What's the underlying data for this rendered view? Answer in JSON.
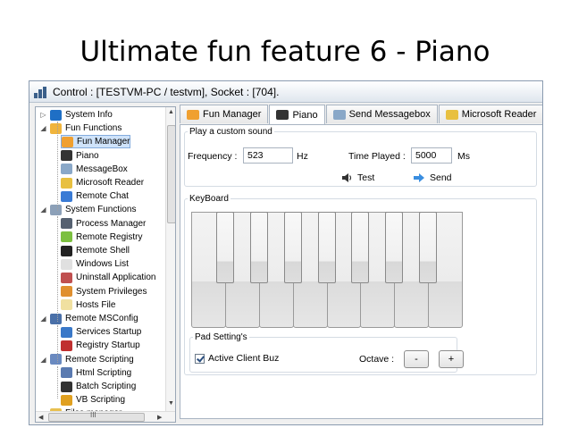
{
  "slide": {
    "title": "Ultimate fun feature 6 - Piano"
  },
  "window": {
    "title": "Control : [TESTVM-PC / testvm], Socket : [704]."
  },
  "tree": {
    "items": [
      {
        "label": "System Info",
        "level": 0,
        "expander": "▷",
        "icon": "info-icon",
        "color": "#1f6fc5"
      },
      {
        "label": "Fun Functions",
        "level": 0,
        "expander": "◢",
        "icon": "smiley-folder-icon",
        "color": "#f0b43c"
      },
      {
        "label": "Fun Manager",
        "level": 1,
        "expander": "",
        "icon": "fun-manager-icon",
        "color": "#f0a030",
        "selected": true
      },
      {
        "label": "Piano",
        "level": 1,
        "expander": "",
        "icon": "piano-icon",
        "color": "#333333"
      },
      {
        "label": "MessageBox",
        "level": 1,
        "expander": "",
        "icon": "messagebox-icon",
        "color": "#8aa8c8"
      },
      {
        "label": "Microsoft Reader",
        "level": 1,
        "expander": "",
        "icon": "reader-icon",
        "color": "#e8c040"
      },
      {
        "label": "Remote Chat",
        "level": 1,
        "expander": "",
        "icon": "chat-icon",
        "color": "#3a7bd5"
      },
      {
        "label": "System Functions",
        "level": 0,
        "expander": "◢",
        "icon": "system-functions-icon",
        "color": "#8ca0b8"
      },
      {
        "label": "Process Manager",
        "level": 1,
        "expander": "",
        "icon": "process-manager-icon",
        "color": "#556070"
      },
      {
        "label": "Remote Registry",
        "level": 1,
        "expander": "",
        "icon": "registry-icon",
        "color": "#7cc040"
      },
      {
        "label": "Remote Shell",
        "level": 1,
        "expander": "",
        "icon": "shell-icon",
        "color": "#222222"
      },
      {
        "label": "Windows List",
        "level": 1,
        "expander": "",
        "icon": "windows-list-icon",
        "color": "#e0e0e0"
      },
      {
        "label": "Uninstall Application",
        "level": 1,
        "expander": "",
        "icon": "uninstall-icon",
        "color": "#c05050"
      },
      {
        "label": "System Privileges",
        "level": 1,
        "expander": "",
        "icon": "privileges-icon",
        "color": "#e09030"
      },
      {
        "label": "Hosts File",
        "level": 1,
        "expander": "",
        "icon": "hosts-file-icon",
        "color": "#f0e0a0"
      },
      {
        "label": "Remote MSConfig",
        "level": 0,
        "expander": "◢",
        "icon": "msconfig-icon",
        "color": "#4a70a8"
      },
      {
        "label": "Services Startup",
        "level": 1,
        "expander": "",
        "icon": "services-icon",
        "color": "#3a78c8"
      },
      {
        "label": "Registry Startup",
        "level": 1,
        "expander": "",
        "icon": "registry-startup-icon",
        "color": "#c03030"
      },
      {
        "label": "Remote Scripting",
        "level": 0,
        "expander": "◢",
        "icon": "scripting-icon",
        "color": "#6a8ac0"
      },
      {
        "label": "Html Scripting",
        "level": 1,
        "expander": "",
        "icon": "html-icon",
        "color": "#5a7ab0"
      },
      {
        "label": "Batch Scripting",
        "level": 1,
        "expander": "",
        "icon": "batch-icon",
        "color": "#333333"
      },
      {
        "label": "VB Scripting",
        "level": 1,
        "expander": "",
        "icon": "vb-icon",
        "color": "#e0a020"
      },
      {
        "label": "Files manager",
        "level": 0,
        "expander": "▷",
        "icon": "files-icon",
        "color": "#e8c050"
      }
    ],
    "hscroll_label": "III"
  },
  "tabs": [
    {
      "label": "Fun Manager",
      "icon": "fun-manager-icon",
      "color": "#f0a030",
      "active": false
    },
    {
      "label": "Piano",
      "icon": "piano-icon",
      "color": "#333333",
      "active": true
    },
    {
      "label": "Send Messagebox",
      "icon": "messagebox-icon",
      "color": "#8aa8c8",
      "active": false
    },
    {
      "label": "Microsoft Reader",
      "icon": "reader-icon",
      "color": "#e8c040",
      "active": false
    }
  ],
  "custom_sound": {
    "group_label": "Play a custom sound",
    "frequency_label": "Frequency :",
    "frequency_value": "523",
    "frequency_unit": "Hz",
    "time_label": "Time Played :",
    "time_value": "5000",
    "time_unit": "Ms",
    "test_label": "Test",
    "send_label": "Send"
  },
  "keyboard": {
    "group_label": "KeyBoard",
    "white_keys": 8,
    "black_keys": 7
  },
  "pad": {
    "group_label": "Pad Setting's",
    "active_buz_label": "Active Client Buz",
    "active_buz_checked": true,
    "octave_label": "Octave :",
    "minus_label": "-",
    "plus_label": "+"
  },
  "colors": {
    "accent": "#3a7bd5",
    "selection": "#cfe3fa",
    "border": "#a8b4c2"
  }
}
